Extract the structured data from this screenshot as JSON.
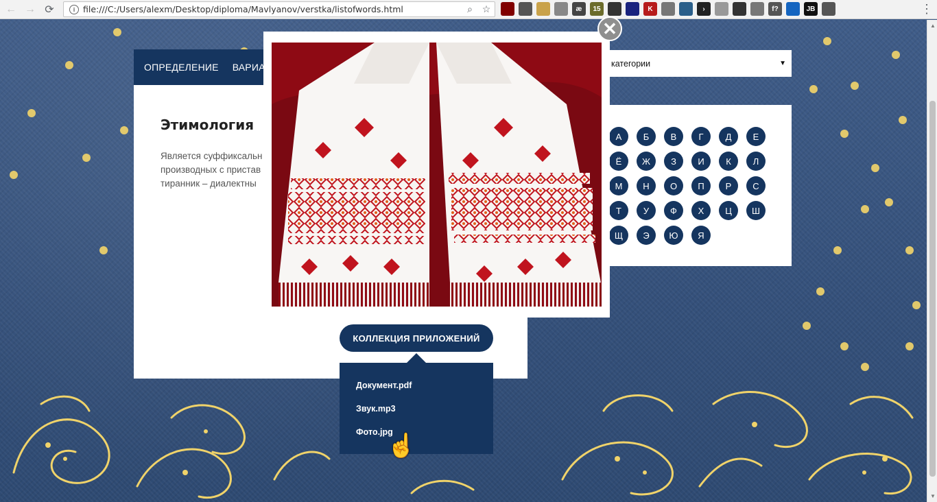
{
  "browser": {
    "url": "file:///C:/Users/alexm/Desktop/diploma/Mavlyanov/verstka/listofwords.html",
    "back_icon": "←",
    "forward_icon": "→",
    "reload_icon": "⟳",
    "info_icon": "i",
    "zoom_icon": "⌕",
    "star_icon": "☆",
    "menu_icon": "⋮",
    "extensions": [
      {
        "name": "ublock",
        "label": "",
        "color": "#800000"
      },
      {
        "name": "eyedropper",
        "label": "",
        "color": "#555555"
      },
      {
        "name": "ruler",
        "label": "",
        "color": "#c9a24a"
      },
      {
        "name": "shield",
        "label": "",
        "color": "#888888"
      },
      {
        "name": "ae",
        "label": "æ",
        "color": "#444444"
      },
      {
        "name": "lock",
        "label": "15",
        "color": "#6b6b2a"
      },
      {
        "name": "film",
        "label": "",
        "color": "#333333"
      },
      {
        "name": "monitor",
        "label": "",
        "color": "#1a237e"
      },
      {
        "name": "k",
        "label": "K",
        "color": "#b71c1c"
      },
      {
        "name": "swirl",
        "label": "",
        "color": "#777777"
      },
      {
        "name": "palette",
        "label": "",
        "color": "#2b5f8a"
      },
      {
        "name": "next",
        "label": "›",
        "color": "#222222"
      },
      {
        "name": "gradient",
        "label": "",
        "color": "#999999"
      },
      {
        "name": "evernote",
        "label": "",
        "color": "#333333"
      },
      {
        "name": "cube",
        "label": "",
        "color": "#777777"
      },
      {
        "name": "fx",
        "label": "f?",
        "color": "#555555"
      },
      {
        "name": "sync",
        "label": "",
        "color": "#1565c0"
      },
      {
        "name": "jb",
        "label": "JB",
        "color": "#111111"
      },
      {
        "name": "hand",
        "label": "",
        "color": "#555555"
      }
    ]
  },
  "tabs": [
    "ОПРЕДЕЛЕНИЕ",
    "ВАРИАНТ"
  ],
  "etymology": {
    "title": "Этимология",
    "lines": [
      "Является суффиксальн",
      "производных с пристав",
      "тиранник – диалектны"
    ]
  },
  "collection_button": "КОЛЛЕКЦИЯ ПРИЛОЖЕНИЙ",
  "dropdown_items": [
    "Документ.pdf",
    "Звук.mp3",
    "Фото.jpg"
  ],
  "category_select": {
    "value": "категории",
    "arrow": "▼"
  },
  "alphabet": [
    "А",
    "Б",
    "В",
    "Г",
    "Д",
    "Е",
    "Ё",
    "Ж",
    "З",
    "И",
    "К",
    "Л",
    "М",
    "Н",
    "О",
    "П",
    "Р",
    "С",
    "Т",
    "У",
    "Ф",
    "Х",
    "Ц",
    "Ш",
    "Щ",
    "Э",
    "Ю",
    "Я"
  ],
  "modal": {
    "close_icon": "✕"
  },
  "cursor_icon": "☝",
  "colors": {
    "navy": "#15355f",
    "dot_yellow": "#f0d36a",
    "towel_red": "#c0141e"
  }
}
